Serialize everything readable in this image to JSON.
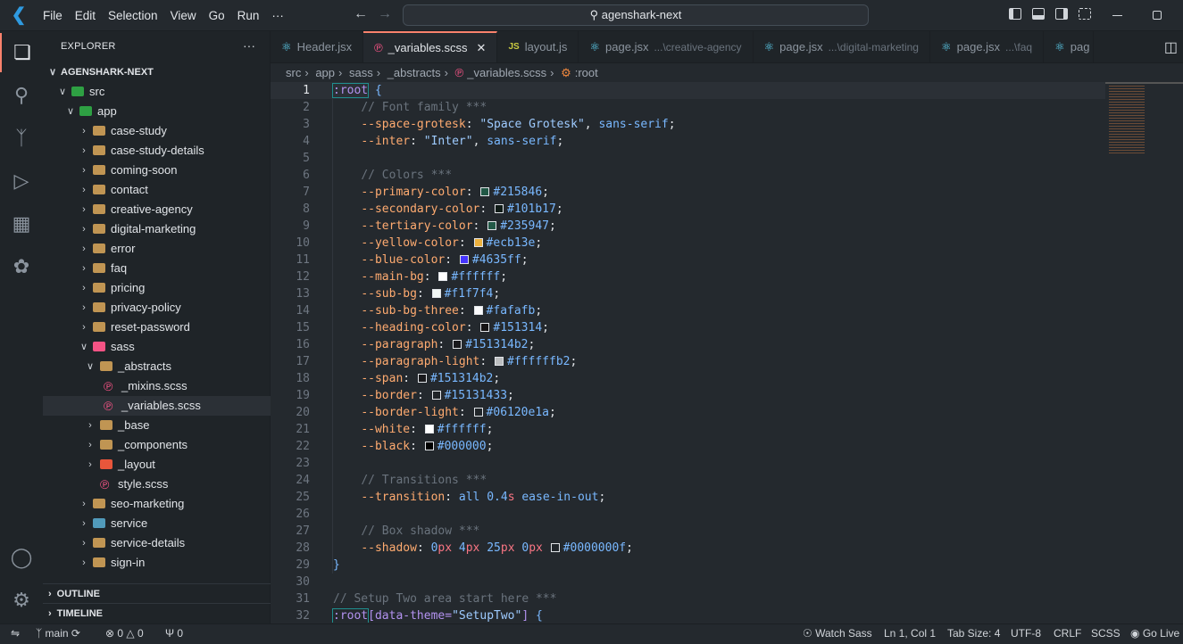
{
  "titlebar": {
    "menu": [
      "File",
      "Edit",
      "Selection",
      "View",
      "Go",
      "Run",
      "···"
    ],
    "search": "agenshark-next"
  },
  "sidebar": {
    "title": "EXPLORER",
    "more": "···",
    "root": "AGENSHARK-NEXT",
    "items": [
      {
        "label": "src",
        "level": 0,
        "chev": "open",
        "icon": "#2ea043"
      },
      {
        "label": "app",
        "level": 1,
        "chev": "open",
        "icon": "#2ea043"
      },
      {
        "label": "case-study",
        "level": 2,
        "chev": "closed",
        "icon": "#c09553"
      },
      {
        "label": "case-study-details",
        "level": 2,
        "chev": "closed",
        "icon": "#c09553"
      },
      {
        "label": "coming-soon",
        "level": 2,
        "chev": "closed",
        "icon": "#c09553"
      },
      {
        "label": "contact",
        "level": 2,
        "chev": "closed",
        "icon": "#c09553"
      },
      {
        "label": "creative-agency",
        "level": 2,
        "chev": "closed",
        "icon": "#c09553"
      },
      {
        "label": "digital-marketing",
        "level": 2,
        "chev": "closed",
        "icon": "#c09553"
      },
      {
        "label": "error",
        "level": 2,
        "chev": "closed",
        "icon": "#c09553"
      },
      {
        "label": "faq",
        "level": 2,
        "chev": "closed",
        "icon": "#c09553"
      },
      {
        "label": "pricing",
        "level": 2,
        "chev": "closed",
        "icon": "#c09553"
      },
      {
        "label": "privacy-policy",
        "level": 2,
        "chev": "closed",
        "icon": "#c09553"
      },
      {
        "label": "reset-password",
        "level": 2,
        "chev": "closed",
        "icon": "#c09553"
      },
      {
        "label": "sass",
        "level": 2,
        "chev": "open",
        "icon": "#f55385"
      },
      {
        "label": "_abstracts",
        "level": 3,
        "chev": "open",
        "icon": "#c09553"
      },
      {
        "label": "_mixins.scss",
        "level": 4,
        "chev": "none",
        "icon": "sass"
      },
      {
        "label": "_variables.scss",
        "level": 4,
        "chev": "none",
        "icon": "sass",
        "selected": true
      },
      {
        "label": "_base",
        "level": 3,
        "chev": "closed",
        "icon": "#c09553"
      },
      {
        "label": "_components",
        "level": 3,
        "chev": "closed",
        "icon": "#c09553"
      },
      {
        "label": "_layout",
        "level": 3,
        "chev": "closed",
        "icon": "#e8563b"
      },
      {
        "label": "style.scss",
        "level": 3,
        "chev": "none",
        "icon": "sass"
      },
      {
        "label": "seo-marketing",
        "level": 2,
        "chev": "closed",
        "icon": "#c09553"
      },
      {
        "label": "service",
        "level": 2,
        "chev": "closed",
        "icon": "#519aba"
      },
      {
        "label": "service-details",
        "level": 2,
        "chev": "closed",
        "icon": "#c09553"
      },
      {
        "label": "sign-in",
        "level": 2,
        "chev": "closed",
        "icon": "#c09553"
      }
    ],
    "outline": "OUTLINE",
    "timeline": "TIMELINE"
  },
  "tabs": [
    {
      "label": "Header.jsx",
      "icon": "react",
      "desc": ""
    },
    {
      "label": "_variables.scss",
      "icon": "sass",
      "desc": "",
      "active": true,
      "close": "✕"
    },
    {
      "label": "layout.js",
      "icon": "js",
      "desc": ""
    },
    {
      "label": "page.jsx",
      "icon": "react",
      "desc": "...\\creative-agency"
    },
    {
      "label": "page.jsx",
      "icon": "react",
      "desc": "...\\digital-marketing"
    },
    {
      "label": "page.jsx",
      "icon": "react",
      "desc": "...\\faq"
    },
    {
      "label": "pag",
      "icon": "react",
      "desc": ""
    }
  ],
  "breadcrumbs": [
    "src",
    "app",
    "sass",
    "_abstracts",
    "_variables.scss",
    ":root"
  ],
  "editor": {
    "current_line": 1,
    "lines": [
      [
        [
          "k",
          ":root"
        ],
        [
          "t",
          " "
        ],
        [
          "v",
          "{"
        ]
      ],
      [
        [
          "t",
          "    "
        ],
        [
          "c",
          "// Font family ***"
        ]
      ],
      [
        [
          "t",
          "    "
        ],
        [
          "p",
          "--space-grotesk"
        ],
        [
          "t",
          ": "
        ],
        [
          "s",
          "\"Space Grotesk\""
        ],
        [
          "t",
          ", "
        ],
        [
          "v",
          "sans-serif"
        ],
        [
          "t",
          ";"
        ]
      ],
      [
        [
          "t",
          "    "
        ],
        [
          "p",
          "--inter"
        ],
        [
          "t",
          ": "
        ],
        [
          "s",
          "\"Inter\""
        ],
        [
          "t",
          ", "
        ],
        [
          "v",
          "sans-serif"
        ],
        [
          "t",
          ";"
        ]
      ],
      [],
      [
        [
          "t",
          "    "
        ],
        [
          "c",
          "// Colors ***"
        ]
      ],
      [
        [
          "t",
          "    "
        ],
        [
          "p",
          "--primary-color"
        ],
        [
          "t",
          ": "
        ],
        [
          "sw",
          "#215846"
        ],
        [
          "v",
          "#215846"
        ],
        [
          "t",
          ";"
        ]
      ],
      [
        [
          "t",
          "    "
        ],
        [
          "p",
          "--secondary-color"
        ],
        [
          "t",
          ": "
        ],
        [
          "sw",
          "#101b17"
        ],
        [
          "v",
          "#101b17"
        ],
        [
          "t",
          ";"
        ]
      ],
      [
        [
          "t",
          "    "
        ],
        [
          "p",
          "--tertiary-color"
        ],
        [
          "t",
          ": "
        ],
        [
          "sw",
          "#235947"
        ],
        [
          "v",
          "#235947"
        ],
        [
          "t",
          ";"
        ]
      ],
      [
        [
          "t",
          "    "
        ],
        [
          "p",
          "--yellow-color"
        ],
        [
          "t",
          ": "
        ],
        [
          "sw",
          "#ecb13e"
        ],
        [
          "v",
          "#ecb13e"
        ],
        [
          "t",
          ";"
        ]
      ],
      [
        [
          "t",
          "    "
        ],
        [
          "p",
          "--blue-color"
        ],
        [
          "t",
          ": "
        ],
        [
          "sw",
          "#4635ff"
        ],
        [
          "v",
          "#4635ff"
        ],
        [
          "t",
          ";"
        ]
      ],
      [
        [
          "t",
          "    "
        ],
        [
          "p",
          "--main-bg"
        ],
        [
          "t",
          ": "
        ],
        [
          "sw",
          "#ffffff"
        ],
        [
          "v",
          "#ffffff"
        ],
        [
          "t",
          ";"
        ]
      ],
      [
        [
          "t",
          "    "
        ],
        [
          "p",
          "--sub-bg"
        ],
        [
          "t",
          ": "
        ],
        [
          "sw",
          "#f1f7f4"
        ],
        [
          "v",
          "#f1f7f4"
        ],
        [
          "t",
          ";"
        ]
      ],
      [
        [
          "t",
          "    "
        ],
        [
          "p",
          "--sub-bg-three"
        ],
        [
          "t",
          ": "
        ],
        [
          "sw",
          "#fafafb"
        ],
        [
          "v",
          "#fafafb"
        ],
        [
          "t",
          ";"
        ]
      ],
      [
        [
          "t",
          "    "
        ],
        [
          "p",
          "--heading-color"
        ],
        [
          "t",
          ": "
        ],
        [
          "sw",
          "#151314"
        ],
        [
          "v",
          "#151314"
        ],
        [
          "t",
          ";"
        ]
      ],
      [
        [
          "t",
          "    "
        ],
        [
          "p",
          "--paragraph"
        ],
        [
          "t",
          ": "
        ],
        [
          "sw",
          "#151314b2"
        ],
        [
          "v",
          "#151314b2"
        ],
        [
          "t",
          ";"
        ]
      ],
      [
        [
          "t",
          "    "
        ],
        [
          "p",
          "--paragraph-light"
        ],
        [
          "t",
          ": "
        ],
        [
          "sw",
          "#ffffffb2"
        ],
        [
          "v",
          "#ffffffb2"
        ],
        [
          "t",
          ";"
        ]
      ],
      [
        [
          "t",
          "    "
        ],
        [
          "p",
          "--span"
        ],
        [
          "t",
          ": "
        ],
        [
          "sw",
          "#151314b2"
        ],
        [
          "v",
          "#151314b2"
        ],
        [
          "t",
          ";"
        ]
      ],
      [
        [
          "t",
          "    "
        ],
        [
          "p",
          "--border"
        ],
        [
          "t",
          ": "
        ],
        [
          "sw",
          "#15131433"
        ],
        [
          "v",
          "#15131433"
        ],
        [
          "t",
          ";"
        ]
      ],
      [
        [
          "t",
          "    "
        ],
        [
          "p",
          "--border-light"
        ],
        [
          "t",
          ": "
        ],
        [
          "sw",
          "#06120e1a"
        ],
        [
          "v",
          "#06120e1a"
        ],
        [
          "t",
          ";"
        ]
      ],
      [
        [
          "t",
          "    "
        ],
        [
          "p",
          "--white"
        ],
        [
          "t",
          ": "
        ],
        [
          "sw",
          "#ffffff"
        ],
        [
          "v",
          "#ffffff"
        ],
        [
          "t",
          ";"
        ]
      ],
      [
        [
          "t",
          "    "
        ],
        [
          "p",
          "--black"
        ],
        [
          "t",
          ": "
        ],
        [
          "sw",
          "#000000"
        ],
        [
          "v",
          "#000000"
        ],
        [
          "t",
          ";"
        ]
      ],
      [],
      [
        [
          "t",
          "    "
        ],
        [
          "c",
          "// Transitions ***"
        ]
      ],
      [
        [
          "t",
          "    "
        ],
        [
          "p",
          "--transition"
        ],
        [
          "t",
          ": "
        ],
        [
          "v",
          "all "
        ],
        [
          "n",
          "0.4"
        ],
        [
          "u",
          "s"
        ],
        [
          "v",
          " ease-in-out"
        ],
        [
          "t",
          ";"
        ]
      ],
      [],
      [
        [
          "t",
          "    "
        ],
        [
          "c",
          "// Box shadow ***"
        ]
      ],
      [
        [
          "t",
          "    "
        ],
        [
          "p",
          "--shadow"
        ],
        [
          "t",
          ": "
        ],
        [
          "n",
          "0"
        ],
        [
          "u",
          "px"
        ],
        [
          "t",
          " "
        ],
        [
          "n",
          "4"
        ],
        [
          "u",
          "px"
        ],
        [
          "t",
          " "
        ],
        [
          "n",
          "25"
        ],
        [
          "u",
          "px"
        ],
        [
          "t",
          " "
        ],
        [
          "n",
          "0"
        ],
        [
          "u",
          "px"
        ],
        [
          "t",
          " "
        ],
        [
          "sw",
          "#0000000f"
        ],
        [
          "v",
          "#0000000f"
        ],
        [
          "t",
          ";"
        ]
      ],
      [
        [
          "v",
          "}"
        ]
      ],
      [],
      [
        [
          "c",
          "// Setup Two area start here ***"
        ]
      ],
      [
        [
          "k",
          ":root"
        ],
        [
          "k",
          "[data-theme="
        ],
        [
          "s",
          "\"SetupTwo\""
        ],
        [
          "k",
          "]"
        ],
        [
          "t",
          " "
        ],
        [
          "v",
          "{"
        ]
      ]
    ]
  },
  "statusbar": {
    "branch": "main",
    "errors": "0",
    "warnings": "0",
    "ports": "0",
    "watch_sass": "Watch Sass",
    "position": "Ln 1, Col 1",
    "tab_size": "Tab Size: 4",
    "encoding": "UTF-8",
    "eol": "CRLF",
    "language": "SCSS",
    "go_live": "Go Live"
  }
}
